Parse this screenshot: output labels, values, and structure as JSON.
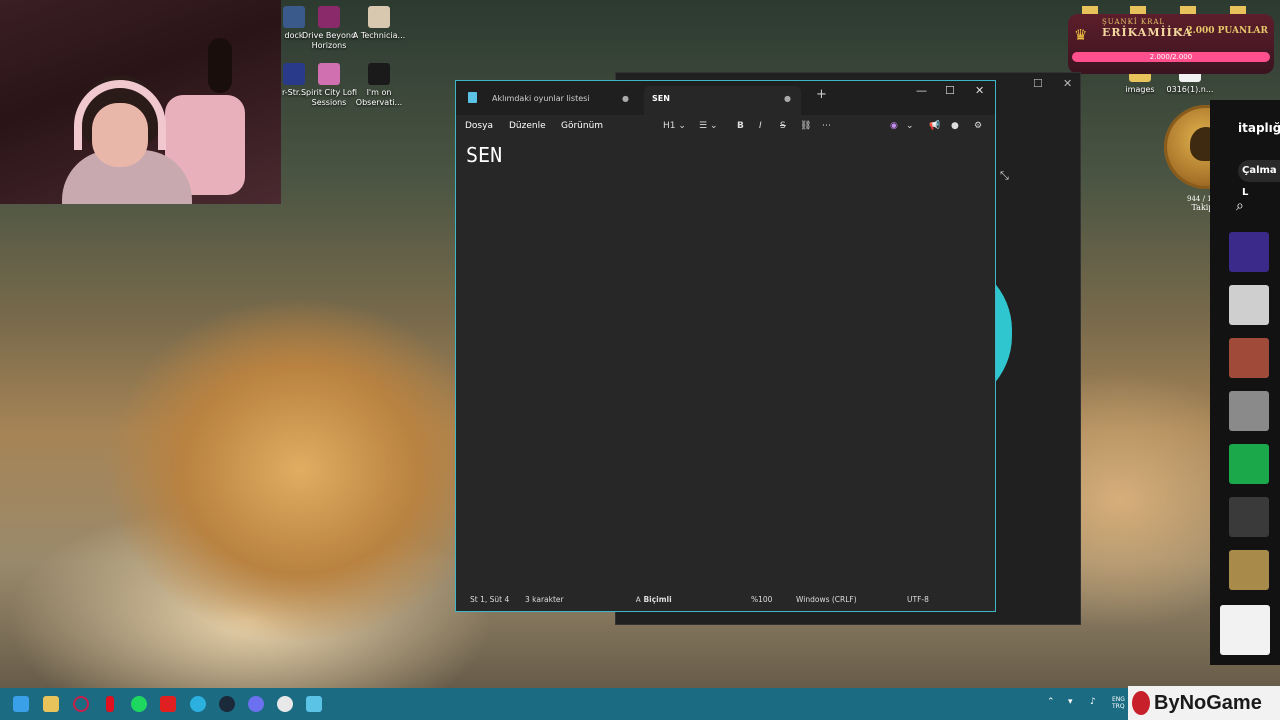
{
  "desktop": {
    "icons": [
      {
        "label": "dock",
        "color": "#3a5a8c"
      },
      {
        "label": "Drive Beyond Horizons",
        "color": "#8a2a6a"
      },
      {
        "label": "A Technicia...",
        "color": "#d8c8b0"
      },
      {
        "label": "r-Str...",
        "color": "#2a3a8a"
      },
      {
        "label": "Spirit City Lofi Sessions",
        "color": "#d070b0"
      },
      {
        "label": "I'm on Observati...",
        "color": "#1a1a1a"
      },
      {
        "label": "images",
        "color": "#e8c25a"
      },
      {
        "label": "0316(1).n...",
        "color": "#f2f2f2"
      }
    ]
  },
  "overlay": {
    "king_small": "ŞUANKİ KRAL",
    "king_name": "ERİKAMİİKA",
    "king_points": "• 2.000 PUANLAR",
    "king_bar": "2.000/2.000",
    "followers": "944 / 1000",
    "followers_label": "Takipçi"
  },
  "spotify": {
    "title": "itaplığ",
    "chip": "Çalma L",
    "tile_colors": [
      "#3b2a8a",
      "#cfcfcf",
      "#a04a3a",
      "#8a8a8a",
      "#1aa84a",
      "#3a3a3a",
      "#a88a4a",
      "#f2f2f2"
    ]
  },
  "notepad": {
    "tab1": "Aklımdaki oyunlar listesi",
    "tab2": "SEN",
    "menu": {
      "file": "Dosya",
      "edit": "Düzenle",
      "view": "Görünüm"
    },
    "heading": "H1",
    "content": "SEN",
    "status": {
      "position": "St 1, Süt 4",
      "chars": "3 karakter",
      "format": "Biçimli",
      "zoom": "%100",
      "eol": "Windows (CRLF)",
      "encoding": "UTF-8"
    }
  },
  "taskbar": {
    "icons": [
      "windows-icon",
      "file-explorer-icon",
      "app-red-ring-icon",
      "netflix-icon",
      "spotify-icon",
      "youtube-icon",
      "edge-icon",
      "steam-icon",
      "discord-icon",
      "clock-app-icon",
      "notepad-icon"
    ],
    "tray_lang": "ENG TRQ",
    "brand": "ByNoGame"
  }
}
